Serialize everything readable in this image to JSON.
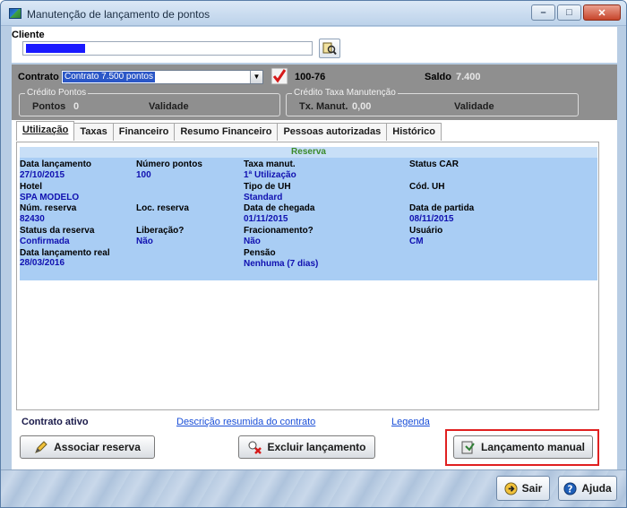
{
  "window": {
    "title": "Manutenção de lançamento de pontos",
    "buttons": {
      "minimize": "–",
      "maximize": "□",
      "close": "✕"
    }
  },
  "cliente": {
    "label": "Cliente"
  },
  "contrato": {
    "label": "Contrato",
    "selected": "Contrato 7.500 pontos",
    "code": "100-76",
    "saldo_label": "Saldo",
    "saldo_value": "7.400"
  },
  "credito_pontos": {
    "title": "Crédito Pontos",
    "pontos_label": "Pontos",
    "pontos_value": "0",
    "validade_label": "Validade"
  },
  "credito_taxa": {
    "title": "Crédito Taxa Manutenção",
    "tx_label": "Tx. Manut.",
    "tx_value": "0,00",
    "validade_label": "Validade"
  },
  "tabs": [
    "Utilização",
    "Taxas",
    "Financeiro",
    "Resumo Financeiro",
    "Pessoas autorizadas",
    "Histórico"
  ],
  "reserva": {
    "header": "Reserva",
    "data_lancamento_label": "Data lançamento",
    "data_lancamento": "27/10/2015",
    "numero_pontos_label": "Número pontos",
    "numero_pontos": "100",
    "taxa_manut_label": "Taxa manut.",
    "taxa_manut": "1ª Utilização",
    "status_car_label": "Status CAR",
    "hotel_label": "Hotel",
    "hotel": "SPA MODELO",
    "tipo_uh_label": "Tipo de UH",
    "tipo_uh": "Standard",
    "cod_uh_label": "Cód. UH",
    "num_reserva_label": "Núm. reserva",
    "num_reserva": "82430",
    "loc_reserva_label": "Loc. reserva",
    "data_chegada_label": "Data de chegada",
    "data_chegada": "01/11/2015",
    "data_partida_label": "Data de partida",
    "data_partida": "08/11/2015",
    "status_reserva_label": "Status da reserva",
    "status_reserva": "Confirmada",
    "liberacao_label": "Liberação?",
    "liberacao": "Não",
    "fracionamento_label": "Fracionamento?",
    "fracionamento": "Não",
    "usuario_label": "Usuário",
    "usuario": "CM",
    "data_real_label": "Data lançamento real",
    "data_real": "28/03/2016",
    "pensao_label": "Pensão",
    "pensao": "Nenhuma (7 dias)"
  },
  "footer": {
    "contrato_ativo": "Contrato ativo",
    "descricao_link": "Descrição resumida do contrato",
    "legenda_link": "Legenda"
  },
  "actions": {
    "associar": "Associar reserva",
    "excluir": "Excluir lançamento",
    "manual": "Lançamento manual",
    "sair": "Sair",
    "ajuda": "Ajuda"
  },
  "colors": {
    "reserva_bg": "#a9cdf4",
    "value_text": "#1010b0",
    "highlight": "#e02020"
  }
}
